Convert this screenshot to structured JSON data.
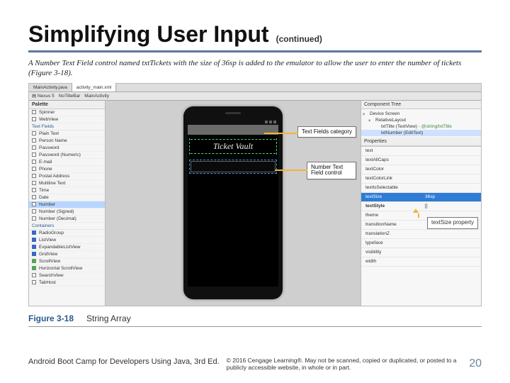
{
  "title": "Simplifying User Input",
  "continued": "(continued)",
  "caption": "A Number Text Field control named txtTickets with the size of 36sp is added to the emulator to allow the user to enter the number of tickets (Figure 3-18).",
  "ide": {
    "tabs": [
      "MainActivity.java",
      "activity_main.xml"
    ],
    "toolbar": {
      "device": "Nexus 5",
      "orientation": "NoTitleBar",
      "activity": "MainActivity"
    },
    "componentTreeTitle": "Component Tree",
    "propertiesTitle": "Properties"
  },
  "palette": {
    "title": "Palette",
    "items": [
      {
        "t": "Spinner",
        "kind": "item",
        "icon": ""
      },
      {
        "t": "WebView",
        "kind": "item",
        "icon": ""
      },
      {
        "t": "Text Fields",
        "kind": "group"
      },
      {
        "t": "Plain Text",
        "kind": "item"
      },
      {
        "t": "Person Name",
        "kind": "item"
      },
      {
        "t": "Password",
        "kind": "item"
      },
      {
        "t": "Password (Numeric)",
        "kind": "item"
      },
      {
        "t": "E-mail",
        "kind": "item"
      },
      {
        "t": "Phone",
        "kind": "item"
      },
      {
        "t": "Postal Address",
        "kind": "item"
      },
      {
        "t": "Multiline Text",
        "kind": "item"
      },
      {
        "t": "Time",
        "kind": "item"
      },
      {
        "t": "Date",
        "kind": "item"
      },
      {
        "t": "Number",
        "kind": "item",
        "hl": true
      },
      {
        "t": "Number (Signed)",
        "kind": "item"
      },
      {
        "t": "Number (Decimal)",
        "kind": "item"
      },
      {
        "t": "Containers",
        "kind": "group"
      },
      {
        "t": "RadioGroup",
        "kind": "item",
        "blue": true
      },
      {
        "t": "ListView",
        "kind": "item",
        "blue": true
      },
      {
        "t": "ExpandableListView",
        "kind": "item",
        "blue": true
      },
      {
        "t": "GridView",
        "kind": "item",
        "blue": true
      },
      {
        "t": "ScrollView",
        "kind": "item",
        "green": true
      },
      {
        "t": "Horizontal ScrollView",
        "kind": "item",
        "green": true
      },
      {
        "t": "SearchView",
        "kind": "item"
      },
      {
        "t": "TabHost",
        "kind": "item"
      }
    ]
  },
  "app": {
    "screenTitle": "Ticket Vault"
  },
  "callouts": {
    "c1": "Text Fields category",
    "c2": "Number Text Field control",
    "c3": "textSize property"
  },
  "tree": {
    "items": [
      {
        "t": "Device Screen",
        "lvl": 0
      },
      {
        "t": "RelativeLayout",
        "lvl": 1
      },
      {
        "t": "txtTitle (TextView)",
        "meta": "- @string/txtTitle",
        "lvl": 2
      },
      {
        "t": "txtNumber (EditText)",
        "lvl": 2,
        "sel": true
      }
    ]
  },
  "properties": [
    {
      "k": "text",
      "v": ""
    },
    {
      "k": "textAllCaps",
      "v": ""
    },
    {
      "k": "textColor",
      "v": ""
    },
    {
      "k": "textColorLink",
      "v": ""
    },
    {
      "k": "textIsSelectable",
      "v": ""
    },
    {
      "k": "textSize",
      "v": "36sp",
      "sel": true
    },
    {
      "k": "textStyle",
      "v": "[]",
      "bold": true
    },
    {
      "k": "theme",
      "v": ""
    },
    {
      "k": "transitionName",
      "v": ""
    },
    {
      "k": "translationZ",
      "v": ""
    },
    {
      "k": "typeface",
      "v": ""
    },
    {
      "k": "visibility",
      "v": ""
    },
    {
      "k": "width",
      "v": ""
    }
  ],
  "figure": {
    "num": "Figure 3-18",
    "name": "String Array"
  },
  "footer": {
    "book": "Android Boot Camp for Developers Using Java, 3rd Ed.",
    "copy": "© 2016 Cengage Learning®. May not be scanned, copied or duplicated, or posted to a publicly accessible website, in whole or in part.",
    "page": "20"
  }
}
